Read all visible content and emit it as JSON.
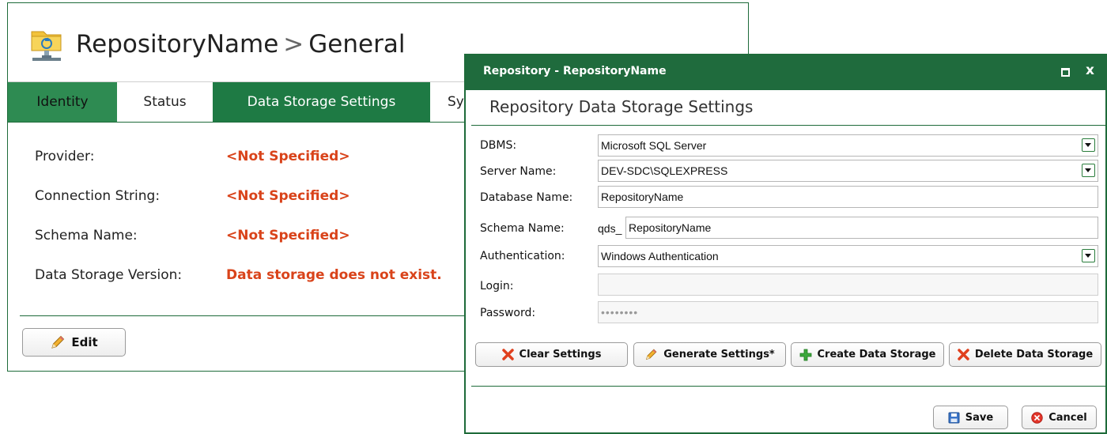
{
  "background_window": {
    "title_repo": "RepositoryName",
    "title_separator": ">",
    "title_page": "General",
    "tabs": [
      "Identity",
      "Status",
      "Data Storage Settings",
      "Sy"
    ],
    "fields": [
      {
        "label": "Provider:",
        "value": "<Not Specified>"
      },
      {
        "label": "Connection String:",
        "value": "<Not Specified>"
      },
      {
        "label": "Schema Name:",
        "value": "<Not Specified>"
      },
      {
        "label": "Data Storage Version:",
        "value": "Data storage does not exist."
      }
    ],
    "edit_label": "Edit"
  },
  "dialog": {
    "title": "Repository - RepositoryName",
    "close_glyph": "x",
    "heading": "Repository Data Storage Settings",
    "form": {
      "dbms_label": "DBMS:",
      "dbms_value": "Microsoft SQL Server",
      "server_label": "Server Name:",
      "server_value": "DEV-SDC\\SQLEXPRESS",
      "database_label": "Database Name:",
      "database_value": "RepositoryName",
      "schema_label": "Schema Name:",
      "schema_prefix": "qds_",
      "schema_value": "RepositoryName",
      "auth_label": "Authentication:",
      "auth_value": "Windows Authentication",
      "login_label": "Login:",
      "login_value": "",
      "password_label": "Password:",
      "password_value": "••••••••"
    },
    "actions": {
      "clear": "Clear Settings",
      "generate": "Generate Settings*",
      "create": "Create Data Storage",
      "delete": "Delete Data Storage"
    },
    "footer": {
      "save": "Save",
      "cancel": "Cancel"
    }
  },
  "colors": {
    "brand_green": "#1f6b3d",
    "tab_green": "#1e7a44",
    "warning_orange": "#d9431a"
  },
  "icons": [
    "repository-folder-icon",
    "pencil-icon",
    "red-x-icon",
    "green-plus-icon",
    "save-disk-icon",
    "cancel-circle-icon",
    "dropdown-arrow-icon"
  ]
}
